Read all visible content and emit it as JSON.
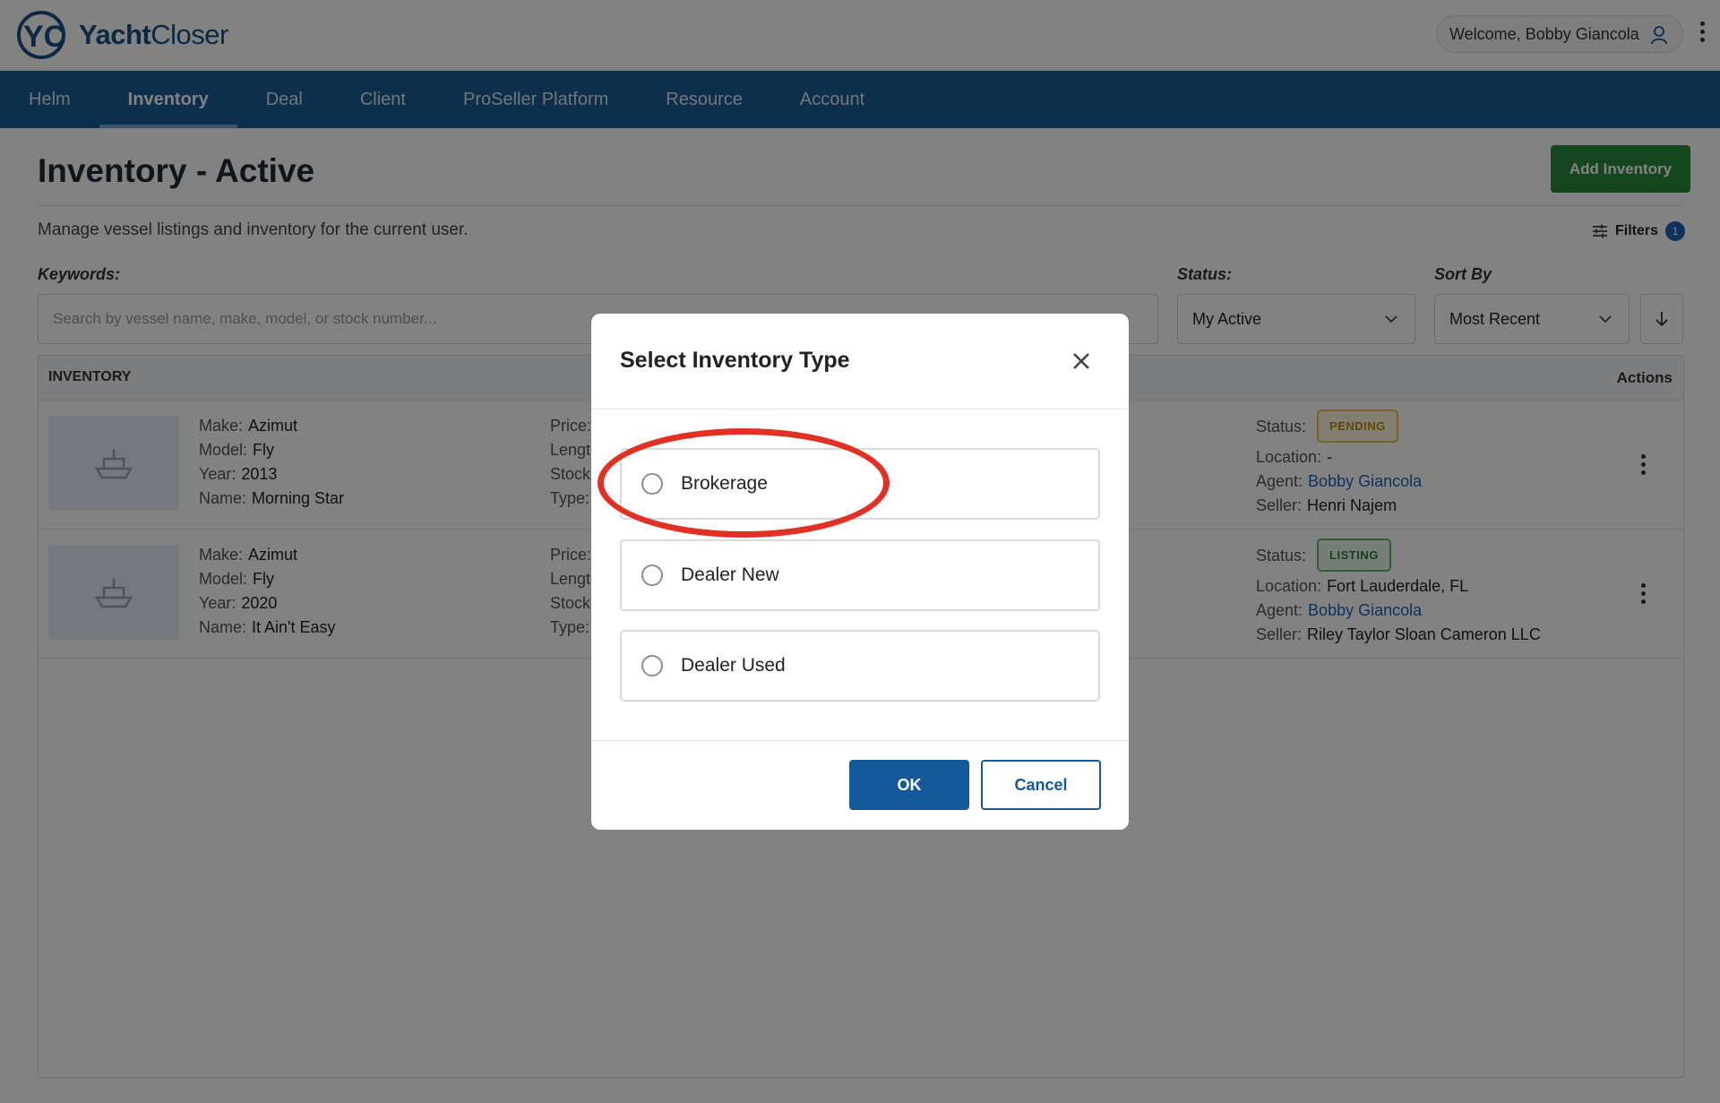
{
  "app": {
    "logo_mark": "YC",
    "logo_bold": "Yacht",
    "logo_light": "Closer",
    "welcome": "Welcome, Bobby Giancola"
  },
  "nav": {
    "items": [
      {
        "label": "Helm"
      },
      {
        "label": "Inventory"
      },
      {
        "label": "Deal"
      },
      {
        "label": "Client"
      },
      {
        "label": "ProSeller Platform"
      },
      {
        "label": "Resource"
      },
      {
        "label": "Account"
      }
    ],
    "active": "Inventory"
  },
  "page": {
    "title": "Inventory - Active",
    "subtitle": "Manage vessel listings and inventory for the current user.",
    "add_button": "Add Inventory",
    "filters_label": "Filters",
    "filters_count": "1"
  },
  "search": {
    "keywords_label": "Keywords:",
    "placeholder": "Search by vessel name, make, model, or stock number...",
    "status_label": "Status:",
    "status_value": "My Active",
    "sort_label": "Sort By",
    "sort_value": "Most Recent"
  },
  "table": {
    "header_inventory": "INVENTORY",
    "header_actions": "Actions",
    "keys": {
      "make": "Make:",
      "model": "Model:",
      "year": "Year:",
      "name": "Name:",
      "price": "Price:",
      "length": "Length",
      "stock": "Stock",
      "type": "Type:",
      "status": "Status:",
      "location": "Location:",
      "agent": "Agent:",
      "seller": "Seller:"
    },
    "rows": [
      {
        "make": "Azimut",
        "model": "Fly",
        "year": "2013",
        "name": "Morning Star",
        "status": "PENDING",
        "location": "-",
        "agent": "Bobby Giancola",
        "seller": "Henri Najem"
      },
      {
        "make": "Azimut",
        "model": "Fly",
        "year": "2020",
        "name": "It Ain't Easy",
        "status": "LISTING",
        "location": "Fort Lauderdale, FL",
        "agent": "Bobby Giancola",
        "seller": "Riley Taylor Sloan Cameron LLC"
      }
    ]
  },
  "modal": {
    "title": "Select Inventory Type",
    "options": [
      {
        "label": "Brokerage"
      },
      {
        "label": "Dealer New"
      },
      {
        "label": "Dealer Used"
      }
    ],
    "ok": "OK",
    "cancel": "Cancel"
  },
  "colors": {
    "nav_bg": "#1a5d96",
    "primary": "#15599a",
    "add_button": "#2a8a3e",
    "highlight": "#e33024"
  },
  "icons": [
    "user-icon",
    "kebab-icon",
    "filter-icon",
    "chevron-down-icon",
    "arrow-down-icon",
    "boat-icon",
    "close-icon"
  ]
}
